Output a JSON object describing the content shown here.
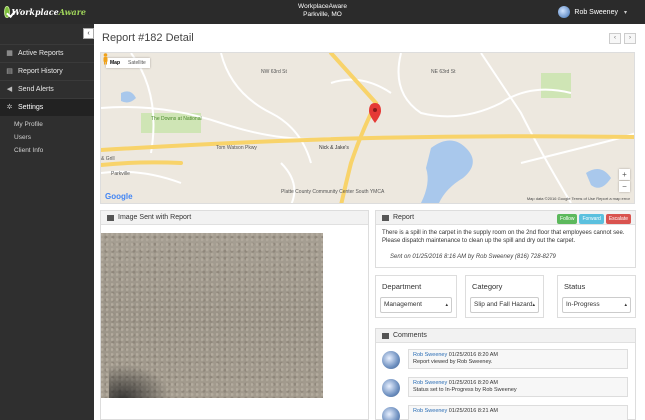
{
  "app": {
    "logo_text_1": "Workplace",
    "logo_text_2": "Aware",
    "title": "WorkplaceAware",
    "location": "Parkville, MO",
    "user_name": "Rob Sweeney"
  },
  "sidebar": {
    "items": [
      {
        "label": "Active Reports",
        "icon": "dashboard-icon",
        "active": false
      },
      {
        "label": "Report History",
        "icon": "history-icon",
        "active": false
      },
      {
        "label": "Send Alerts",
        "icon": "megaphone-icon",
        "active": false
      },
      {
        "label": "Settings",
        "icon": "gear-icon",
        "active": true
      }
    ],
    "sub_items": [
      "My Profile",
      "Users",
      "Client Info"
    ]
  },
  "page": {
    "title": "Report #182 Detail",
    "prev": "‹",
    "next": "›"
  },
  "map": {
    "type_map": "Map",
    "type_satellite": "Satellite",
    "zoom_in": "+",
    "zoom_out": "−",
    "google": "Google",
    "footer": "Map data ©2016 Google   Terms of Use   Report a map error",
    "labels": {
      "road": "Tom Watson Pkwy",
      "nick": "Nick & Jake's",
      "downs": "The Downs at National",
      "community": "Platte County Community Center South YMCA",
      "parkville": "Parkville",
      "grill": "& Grill",
      "st_ne": "NE 63rd St",
      "st_nw": "NW 63rd St"
    }
  },
  "image_panel": {
    "title": "Image Sent with Report"
  },
  "report": {
    "title": "Report",
    "badges": [
      {
        "label": "Follow",
        "color": "#5cb85c"
      },
      {
        "label": "Forward",
        "color": "#5bc0de"
      },
      {
        "label": "Escalate",
        "color": "#d9534f"
      }
    ],
    "text": "There is a spill in the carpet in the supply room on the 2nd floor that employees cannot see. Please dispatch maintenance to clean up the spill and dry out the carpet.",
    "sent": "Sent on 01/25/2016 8:16 AM by Rob Sweeney (816) 728-8279"
  },
  "fields": {
    "department": {
      "label": "Department",
      "value": "Management"
    },
    "category": {
      "label": "Category",
      "value": "Slip and Fall Hazard"
    },
    "status": {
      "label": "Status",
      "value": "In-Progress"
    }
  },
  "comments": {
    "title": "Comments",
    "items": [
      {
        "author": "Rob Sweeney",
        "time": " 01/25/2016 8:20 AM",
        "text": "Report viewed by Rob Sweeney."
      },
      {
        "author": "Rob Sweeney",
        "time": " 01/25/2016 8:20 AM",
        "text": "Status set to In-Progress by Rob Sweeney"
      },
      {
        "author": "Rob Sweeney",
        "time": " 01/25/2016 8:21 AM",
        "text": ""
      }
    ]
  },
  "colors": {
    "topbar": "#2b2b2b",
    "sidebar": "#2f2f2f",
    "accent_link": "#2a6db5",
    "map_marker": "#e53935"
  }
}
